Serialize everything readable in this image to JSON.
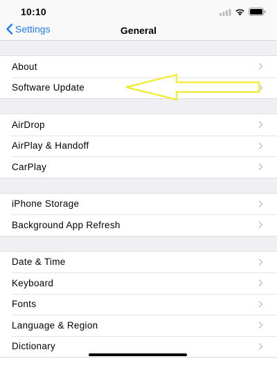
{
  "status_bar": {
    "time": "10:10",
    "icons": [
      "cellular-signal-icon",
      "wifi-icon",
      "battery-icon"
    ]
  },
  "nav": {
    "back_label": "Settings",
    "title": "General"
  },
  "groups": [
    {
      "items": [
        {
          "label": "About"
        },
        {
          "label": "Software Update"
        }
      ]
    },
    {
      "items": [
        {
          "label": "AirDrop"
        },
        {
          "label": "AirPlay & Handoff"
        },
        {
          "label": "CarPlay"
        }
      ]
    },
    {
      "items": [
        {
          "label": "iPhone Storage"
        },
        {
          "label": "Background App Refresh"
        }
      ]
    },
    {
      "items": [
        {
          "label": "Date & Time"
        },
        {
          "label": "Keyboard"
        },
        {
          "label": "Fonts"
        },
        {
          "label": "Language & Region"
        },
        {
          "label": "Dictionary"
        }
      ]
    }
  ],
  "annotation": {
    "icon": "yellow-arrow-outline",
    "color": "#f3ec3a",
    "points_to": "Software Update"
  },
  "colors": {
    "accent": "#1a7cf5",
    "background": "#efeff4",
    "chevron": "#c4c4c7"
  }
}
